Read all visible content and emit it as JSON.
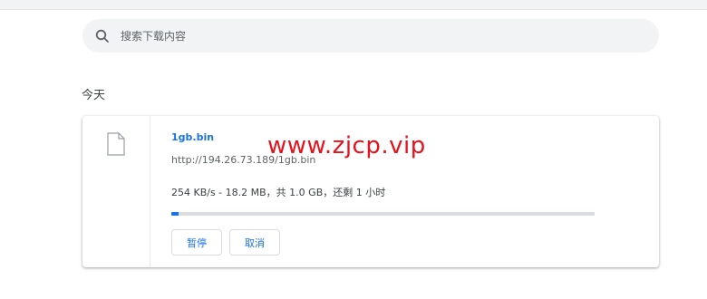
{
  "search": {
    "placeholder": "搜索下载内容"
  },
  "section": {
    "title": "今天"
  },
  "download": {
    "filename": "1gb.bin",
    "url": "http://194.26.73.189/1gb.bin",
    "status": "254 KB/s - 18.2 MB，共 1.0 GB，还剩 1 小时",
    "progress_fraction": 0.0178,
    "pause_label": "暂停",
    "cancel_label": "取消"
  },
  "watermark": {
    "text": "www.zjcp.vip"
  },
  "colors": {
    "accent": "#1a73e8",
    "watermark": "#e8121c"
  },
  "icons": {
    "search": "search-icon",
    "file": "file-icon"
  }
}
